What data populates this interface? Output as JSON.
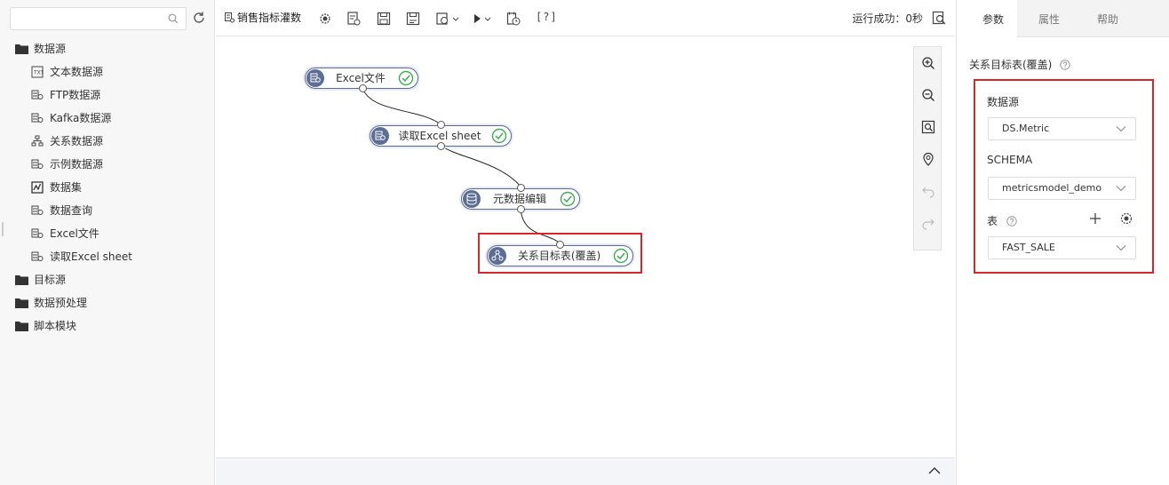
{
  "left_panel": {
    "search": {
      "placeholder": "",
      "value": ""
    },
    "tree": {
      "datasource_folder": "数据源",
      "datasource_items": [
        "文本数据源",
        "FTP数据源",
        "Kafka数据源",
        "关系数据源",
        "示例数据源",
        "数据集",
        "数据查询",
        "Excel文件",
        "读取Excel sheet"
      ],
      "target_folder": "目标源",
      "preprocess_folder": "数据预处理",
      "script_folder": "脚本模块"
    }
  },
  "toolbar": {
    "title": "销售指标灌数",
    "help": "[?]",
    "status": "运行成功：0秒"
  },
  "canvas": {
    "nodes": {
      "excel_file": "Excel文件",
      "read_sheet": "读取Excel sheet",
      "metadata_edit": "元数据编辑",
      "relational_target": "关系目标表(覆盖)"
    }
  },
  "right_panel": {
    "tabs": {
      "params": "参数",
      "props": "属性",
      "help": "帮助"
    },
    "title": "关系目标表(覆盖)",
    "datasource_label": "数据源",
    "datasource_value": "DS.Metric",
    "schema_label": "SCHEMA",
    "schema_value": "metricsmodel_demo",
    "table_label": "表",
    "table_value": "FAST_SALE"
  },
  "colors": {
    "accent_red": "#d9262a",
    "node_icon_bg": "#5c6e94",
    "success_green": "#3cae4e"
  }
}
